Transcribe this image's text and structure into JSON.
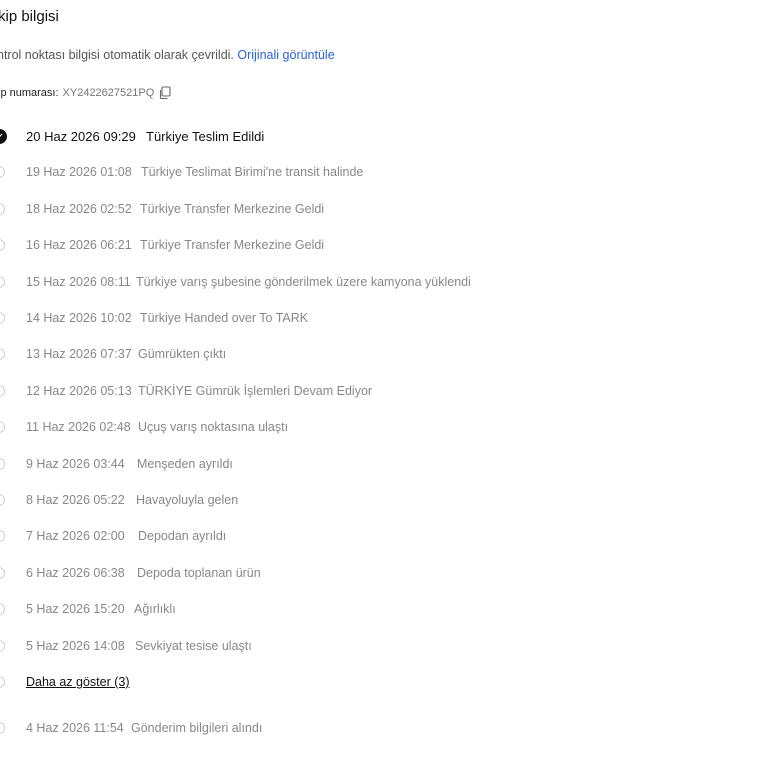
{
  "header": {
    "title": "kip bilgisi"
  },
  "notice": {
    "text": "ntrol noktası bilgisi otomatik olarak çevrildi.",
    "link": "Orijinali görüntüle"
  },
  "tracking": {
    "label": "ip numarası:",
    "number": "XY2422627521PQ",
    "copy_icon": "copy-icon"
  },
  "events": [
    {
      "date": "20 Haz 2026 09:29",
      "desc": "Türkiye Teslim Edildi",
      "active": true
    },
    {
      "date": "19 Haz 2026 01:08",
      "desc": "Türkiye Teslimat Birimi'ne transit halinde"
    },
    {
      "date": "18 Haz 2026 02:52",
      "desc": "Türkiye Transfer Merkezine Geldi"
    },
    {
      "date": "16 Haz 2026 06:21",
      "desc": "Türkiye Transfer Merkezine Geldi"
    },
    {
      "date": "15 Haz 2026 08:11",
      "desc": "Türkiye varış şubesine gönderilmek üzere kamyona yüklendi"
    },
    {
      "date": "14 Haz 2026 10:02",
      "desc": "Türkiye Handed over To TARK"
    },
    {
      "date": "13 Haz 2026 07:37",
      "desc": "Gümrükten çıktı"
    },
    {
      "date": "12 Haz 2026 05:13",
      "desc": "TÜRKİYE Gümrük İşlemleri Devam Ediyor"
    },
    {
      "date": "11 Haz 2026 02:48",
      "desc": "Uçuş varış noktasına ulaştı"
    },
    {
      "date": "9 Haz 2026 03:44",
      "desc": "Menşeden ayrıldı"
    },
    {
      "date": "8 Haz 2026 05:22",
      "desc": "Havayoluyla gelen"
    },
    {
      "date": "7 Haz 2026 02:00",
      "desc": "Depodan ayrıldı"
    },
    {
      "date": "6 Haz 2026 06:38",
      "desc": "Depoda toplanan ürün"
    },
    {
      "date": "5 Haz 2026 15:20",
      "desc": "Ağırlıklı"
    },
    {
      "date": "5 Haz 2026 14:08",
      "desc": "Sevkiyat tesise ulaştı"
    }
  ],
  "show_less": "Daha az göster (3)",
  "last_event": {
    "date": "4 Haz 2026 11:54",
    "desc": "Gönderim bilgileri alındı"
  }
}
